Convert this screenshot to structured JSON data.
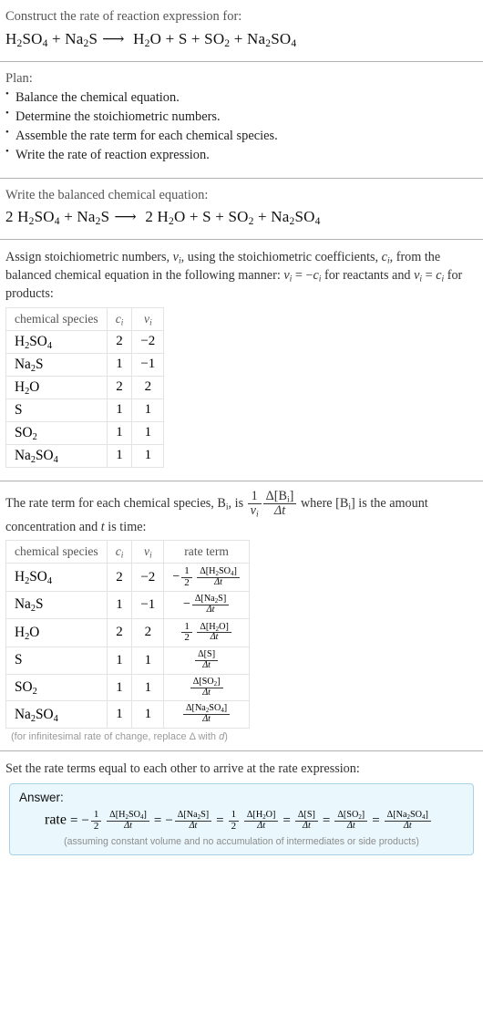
{
  "step1": {
    "prompt": "Construct the rate of reaction expression for:",
    "equation": {
      "reactants": [
        {
          "coef": "",
          "formula": "H2SO4"
        },
        {
          "coef": "",
          "formula": "Na2S"
        }
      ],
      "products": [
        {
          "coef": "",
          "formula": "H2O"
        },
        {
          "coef": "",
          "formula": "S"
        },
        {
          "coef": "",
          "formula": "SO2"
        },
        {
          "coef": "",
          "formula": "Na2SO4"
        }
      ],
      "plain": "H_2SO_4 + Na_2S ⟶ H_2O + S + SO_2 + Na_2SO_4"
    }
  },
  "step2": {
    "title": "Plan:",
    "items": [
      "Balance the chemical equation.",
      "Determine the stoichiometric numbers.",
      "Assemble the rate term for each chemical species.",
      "Write the rate of reaction expression."
    ]
  },
  "step3": {
    "prompt": "Write the balanced chemical equation:",
    "equation": {
      "reactants": [
        {
          "coef": "2",
          "formula": "H2SO4"
        },
        {
          "coef": "",
          "formula": "Na2S"
        }
      ],
      "products": [
        {
          "coef": "2",
          "formula": "H2O"
        },
        {
          "coef": "",
          "formula": "S"
        },
        {
          "coef": "",
          "formula": "SO2"
        },
        {
          "coef": "",
          "formula": "Na2SO4"
        }
      ],
      "plain": "2 H_2SO_4 + Na_2S ⟶ 2 H_2O + S + SO_2 + Na_2SO_4"
    }
  },
  "step4": {
    "prompt_part1": "Assign stoichiometric numbers, ",
    "prompt_part2": ", using the stoichiometric coefficients, ",
    "prompt_part3": ", from the balanced chemical equation in the following manner: ",
    "prompt_part4": " for reactants and ",
    "prompt_part5": " for products:",
    "table": {
      "headers": [
        "chemical species",
        "c_i",
        "v_i"
      ],
      "rows": [
        {
          "species": "H2SO4",
          "c": "2",
          "v": "-2"
        },
        {
          "species": "Na2S",
          "c": "1",
          "v": "-1"
        },
        {
          "species": "H2O",
          "c": "2",
          "v": "2"
        },
        {
          "species": "S",
          "c": "1",
          "v": "1"
        },
        {
          "species": "SO2",
          "c": "1",
          "v": "1"
        },
        {
          "species": "Na2SO4",
          "c": "1",
          "v": "1"
        }
      ]
    }
  },
  "step5": {
    "prompt_part1": "The rate term for each chemical species, ",
    "prompt_part2": ", is ",
    "prompt_part3": " where ",
    "prompt_part4": " is the amount concentration and ",
    "prompt_part5": " is time:",
    "table": {
      "headers": [
        "chemical species",
        "c_i",
        "v_i",
        "rate term"
      ],
      "rows": [
        {
          "species": "H2SO4",
          "c": "2",
          "v": "-2",
          "sign": "-",
          "coef_num": "1",
          "coef_den": "2",
          "delta_num": "Δ[H2SO4]",
          "delta_den": "Δt"
        },
        {
          "species": "Na2S",
          "c": "1",
          "v": "-1",
          "sign": "-",
          "coef_num": "",
          "coef_den": "",
          "delta_num": "Δ[Na2S]",
          "delta_den": "Δt"
        },
        {
          "species": "H2O",
          "c": "2",
          "v": "2",
          "sign": "",
          "coef_num": "1",
          "coef_den": "2",
          "delta_num": "Δ[H2O]",
          "delta_den": "Δt"
        },
        {
          "species": "S",
          "c": "1",
          "v": "1",
          "sign": "",
          "coef_num": "",
          "coef_den": "",
          "delta_num": "Δ[S]",
          "delta_den": "Δt"
        },
        {
          "species": "SO2",
          "c": "1",
          "v": "1",
          "sign": "",
          "coef_num": "",
          "coef_den": "",
          "delta_num": "Δ[SO2]",
          "delta_den": "Δt"
        },
        {
          "species": "Na2SO4",
          "c": "1",
          "v": "1",
          "sign": "",
          "coef_num": "",
          "coef_den": "",
          "delta_num": "Δ[Na2SO4]",
          "delta_den": "Δt"
        }
      ]
    },
    "note": "(for infinitesimal rate of change, replace Δ with d)"
  },
  "step6": {
    "prompt": "Set the rate terms equal to each other to arrive at the rate expression:",
    "answer_label": "Answer:",
    "rate_label": "rate",
    "terms": [
      {
        "sign": "-",
        "coef_num": "1",
        "coef_den": "2",
        "delta_num": "Δ[H2SO4]",
        "delta_den": "Δt"
      },
      {
        "sign": "-",
        "coef_num": "",
        "coef_den": "",
        "delta_num": "Δ[Na2S]",
        "delta_den": "Δt"
      },
      {
        "sign": "",
        "coef_num": "1",
        "coef_den": "2",
        "delta_num": "Δ[H2O]",
        "delta_den": "Δt"
      },
      {
        "sign": "",
        "coef_num": "",
        "coef_den": "",
        "delta_num": "Δ[S]",
        "delta_den": "Δt"
      },
      {
        "sign": "",
        "coef_num": "",
        "coef_den": "",
        "delta_num": "Δ[SO2]",
        "delta_den": "Δt"
      },
      {
        "sign": "",
        "coef_num": "",
        "coef_den": "",
        "delta_num": "Δ[Na2SO4]",
        "delta_den": "Δt"
      }
    ],
    "plain": "rate = -1/2 Δ[H2SO4]/Δt = -Δ[Na2S]/Δt = 1/2 Δ[H2O]/Δt = Δ[S]/Δt = Δ[SO2]/Δt = Δ[Na2SO4]/Δt",
    "caveat": "(assuming constant volume and no accumulation of intermediates or side products)"
  },
  "colors": {
    "answer_bg": "#eaf7fc",
    "answer_border": "#a7d4e4",
    "rule": "#b0b0b0",
    "table_border": "#e3e3e3",
    "muted_text": "#9a9a9a"
  }
}
